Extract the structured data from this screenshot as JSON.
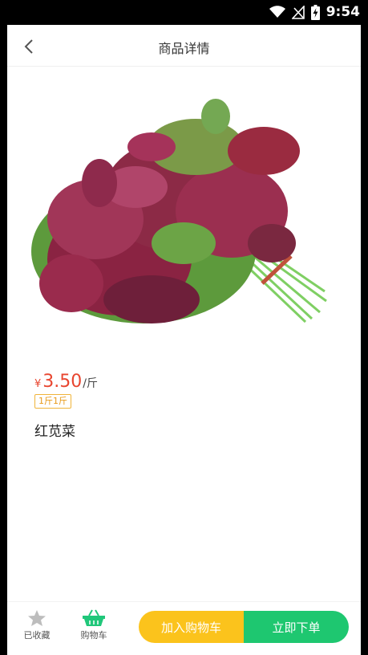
{
  "status_bar": {
    "time": "9:54",
    "icons": [
      "wifi-icon",
      "signal-icon",
      "battery-charging-icon"
    ]
  },
  "header": {
    "title": "商品详情",
    "back_icon": "chevron-left-icon"
  },
  "product": {
    "image_alt_icon": "amaranth-vegetable-image",
    "currency_symbol": "¥",
    "price": "3.50",
    "unit": "/斤",
    "spec": "1斤1斤",
    "name": "红苋菜"
  },
  "bottom_bar": {
    "favorite": {
      "label": "已收藏",
      "icon": "star-icon"
    },
    "cart": {
      "label": "购物车",
      "icon": "basket-icon"
    },
    "add_to_cart": "加入购物车",
    "buy_now": "立即下单"
  },
  "colors": {
    "price": "#e8452f",
    "accent_yellow": "#fbc31c",
    "accent_green": "#1ec770",
    "cart_icon": "#20c77a"
  }
}
